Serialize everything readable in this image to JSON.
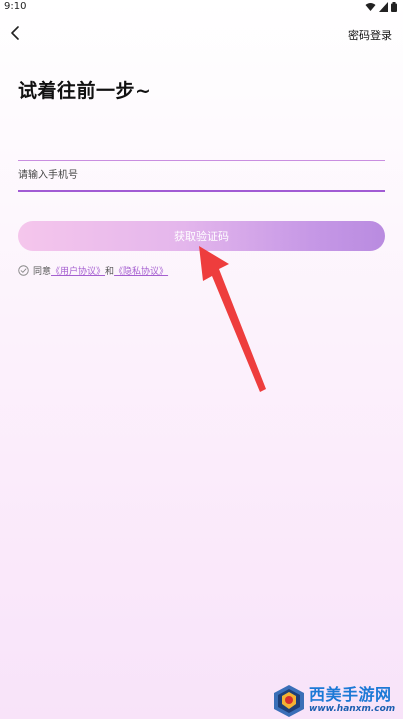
{
  "status_bar": {
    "time": "9:10",
    "icons": [
      "wifi-icon",
      "signal-icon",
      "battery-icon"
    ]
  },
  "header": {
    "back_icon": "chevron-left-icon",
    "password_login": "密码登录"
  },
  "main": {
    "title": "试着往前一步~",
    "phone_input": {
      "placeholder": "请输入手机号",
      "value": ""
    },
    "get_code_button": "获取验证码",
    "agreement": {
      "prefix": "同意",
      "user_agreement": "《用户协议》",
      "and": "和",
      "privacy_policy": "《隐私协议》"
    }
  },
  "watermark": {
    "name": "西美手游网",
    "url": "www.hanxm.com"
  },
  "colors": {
    "accent": "#a15bd4",
    "button_start": "#f5c6ec",
    "button_end": "#b98be0",
    "link": "#a55fd0",
    "annotation_arrow": "#ee3d3d"
  }
}
